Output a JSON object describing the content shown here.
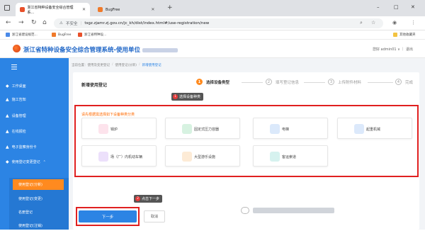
{
  "browser": {
    "tabs": [
      {
        "title": "浙江省特种设备安全综合管理系...",
        "active": true
      },
      {
        "title": "BugFree",
        "active": false
      }
    ],
    "new_tab": "+",
    "controls": {
      "minimize": "–",
      "maximize": "□",
      "close": "✕"
    },
    "address": {
      "security_label": "不安全",
      "url": "tsgz.zjamr.zj.gov.cn/jc_kh/dist/index.html#/use-registration/new"
    },
    "bookmarks": [
      {
        "label": "浙江省建设规范..."
      },
      {
        "label": "BugFree"
      },
      {
        "label": "浙江省特种设..."
      }
    ],
    "bookmarks_right": "其他收藏夹"
  },
  "app": {
    "title": "浙江省特种设备安全综合管理系统-使用单位",
    "user": "您好 admin01 ∨  ｜  退出"
  },
  "sidebar": {
    "items": [
      {
        "label": "工作桌面",
        "icon": "desk-icon"
      },
      {
        "label": "施工告知",
        "icon": "notice-icon"
      },
      {
        "label": "设备管理",
        "icon": "device-icon"
      },
      {
        "label": "在线报检",
        "icon": "inspect-icon"
      },
      {
        "label": "电子监察身份卡",
        "icon": "card-icon"
      },
      {
        "label": "使用登记变更登记",
        "icon": "register-icon"
      }
    ],
    "sub_items": [
      {
        "label": "使用登记(分新)",
        "active": true
      },
      {
        "label": "使用登记(变更)",
        "active": false
      },
      {
        "label": "名册登记",
        "active": false
      },
      {
        "label": "使用登记(注销)",
        "active": false
      }
    ]
  },
  "breadcrumb": [
    "当前位置：使用及变更登记",
    "使用登记(分新)",
    "新增使用登记"
  ],
  "page": {
    "title": "新增使用登记",
    "steps": [
      {
        "num": "1",
        "label": "选择设备类型",
        "active": true
      },
      {
        "num": "2",
        "label": "填写登记信息",
        "active": false
      },
      {
        "num": "3",
        "label": "上传附件材料",
        "active": false
      },
      {
        "num": "4",
        "label": "完成",
        "active": false
      }
    ],
    "hint": "请先根据需选择如下设备种类分类",
    "callout1": {
      "badge": "1",
      "text": "选择设备种类"
    },
    "callout2": {
      "badge": "2",
      "text": "点击下一步"
    },
    "equipment": [
      {
        "label": "锅炉",
        "icon": "boiler-icon",
        "color": "#e85a8a"
      },
      {
        "label": "固定式压力容器",
        "icon": "pressure-vessel-icon",
        "color": "#37b26a"
      },
      {
        "label": "电梯",
        "icon": "elevator-icon",
        "color": "#2f7ee0"
      },
      {
        "label": "起重机械",
        "icon": "crane-icon",
        "color": "#3a8ee8"
      },
      {
        "label": "场（厂）内机动车辆",
        "icon": "vehicle-icon",
        "color": "#8c52d8"
      },
      {
        "label": "大型游乐设施",
        "icon": "amusement-icon",
        "color": "#f0932a"
      },
      {
        "label": "客运索道",
        "icon": "ropeway-icon",
        "color": "#2bb3a6"
      }
    ],
    "next_button": "下一步",
    "cancel_button": "取消"
  },
  "colors": {
    "primary": "#2c84e4",
    "accent": "#ff8a1f",
    "annotation": "#e02020"
  }
}
